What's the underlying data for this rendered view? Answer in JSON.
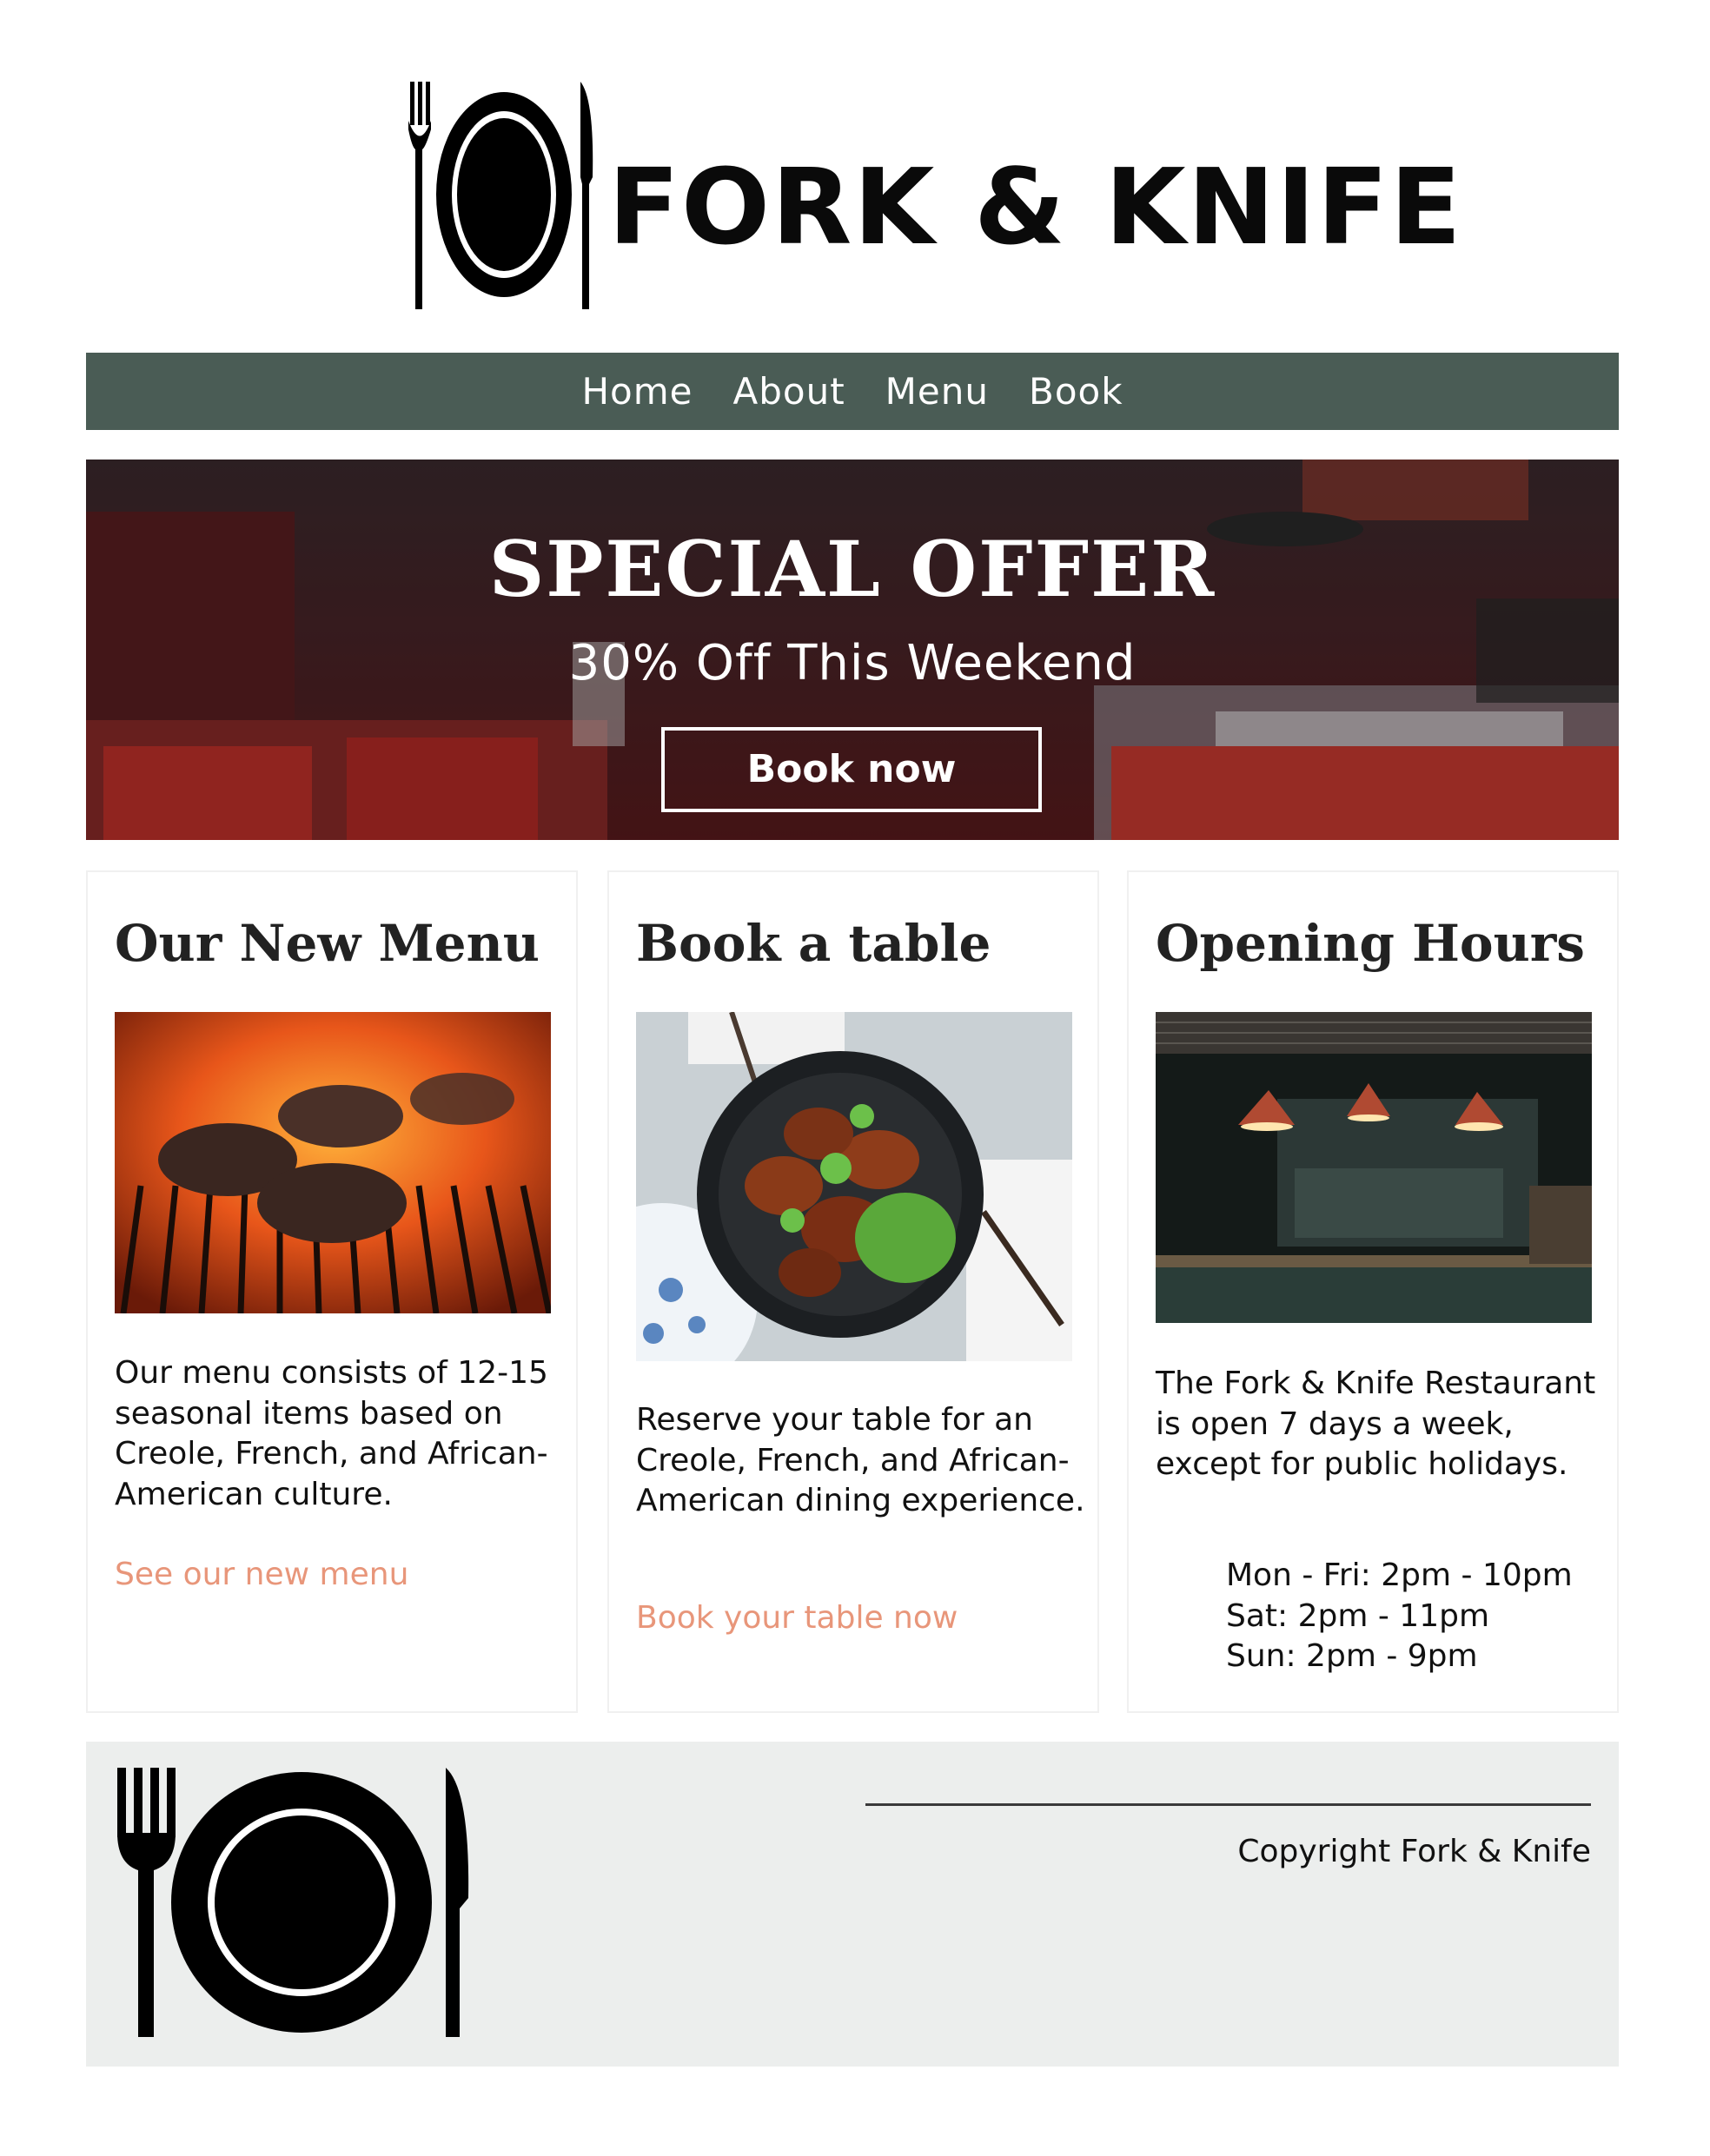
{
  "brand": {
    "name": "FORK & KNIFE",
    "logo_icon": "fork-plate-knife-icon"
  },
  "nav": {
    "items": [
      {
        "label": "Home"
      },
      {
        "label": "About"
      },
      {
        "label": "Menu"
      },
      {
        "label": "Book"
      }
    ]
  },
  "hero": {
    "title": "SPECIAL OFFER",
    "subtitle": "30% Off This Weekend",
    "button_label": "Book now"
  },
  "cards": [
    {
      "title": "Our New Menu",
      "image": "grilled-burger-patties-photo",
      "text": "Our menu consists of 12-15 seasonal items based on Creole, French, and African-American culture.",
      "link_label": "See our new menu"
    },
    {
      "title": "Book a table",
      "image": "chicken-wings-bowl-photo",
      "text": "Reserve your table for an Creole, French, and African-American dining experience.",
      "link_label": "Book your table now"
    },
    {
      "title": "Opening Hours",
      "image": "restaurant-kitchen-photo",
      "text": "The Fork & Knife Restaurant is open 7 days a week, except for public holidays.",
      "hours": [
        "Mon - Fri: 2pm - 10pm",
        "Sat: 2pm - 11pm",
        "Sun: 2pm - 9pm"
      ]
    }
  ],
  "footer": {
    "logo_icon": "fork-plate-knife-icon",
    "copyright": "Copyright Fork & Knife"
  },
  "colors": {
    "nav_bg": "#4a5c55",
    "link": "#e8967a",
    "footer_bg": "#eceeed"
  }
}
